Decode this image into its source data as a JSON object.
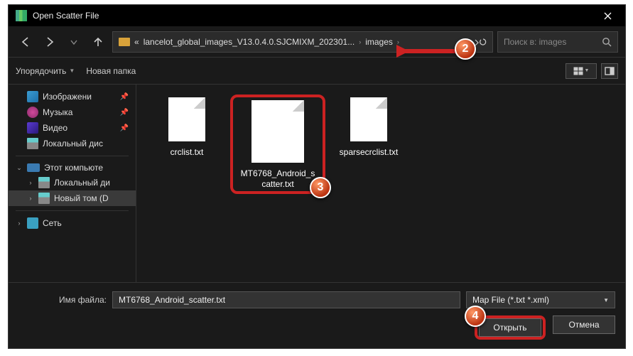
{
  "title": "Open Scatter File",
  "path": {
    "folder": "lancelot_global_images_V13.0.4.0.SJCMIXM_202301...",
    "current": "images"
  },
  "search_placeholder": "Поиск в: images",
  "toolbar": {
    "organize": "Упорядочить",
    "newfolder": "Новая папка"
  },
  "tree": {
    "favs": [
      {
        "label": "Изображени",
        "kind": "img",
        "pinned": true
      },
      {
        "label": "Музыка",
        "kind": "mus",
        "pinned": true
      },
      {
        "label": "Видео",
        "kind": "vid",
        "pinned": true
      },
      {
        "label": "Локальный дис",
        "kind": "disk",
        "pinned": false
      }
    ],
    "pc": {
      "label": "Этот компьюте",
      "children": [
        {
          "label": "Локальный ди",
          "kind": "disk"
        },
        {
          "label": "Новый том (D",
          "kind": "disk",
          "selected": true
        }
      ]
    },
    "net": {
      "label": "Сеть"
    }
  },
  "files": [
    {
      "name": "crclist.txt"
    },
    {
      "name": "MT6768_Android_scatter.txt",
      "selected": true
    },
    {
      "name": "sparsecrclist.txt"
    }
  ],
  "file_label": "Имя файла:",
  "file_value": "MT6768_Android_scatter.txt",
  "file_type": "Map File (*.txt *.xml)",
  "open": "Открыть",
  "cancel": "Отмена",
  "badges": {
    "b2": "2",
    "b3": "3",
    "b4": "4"
  }
}
